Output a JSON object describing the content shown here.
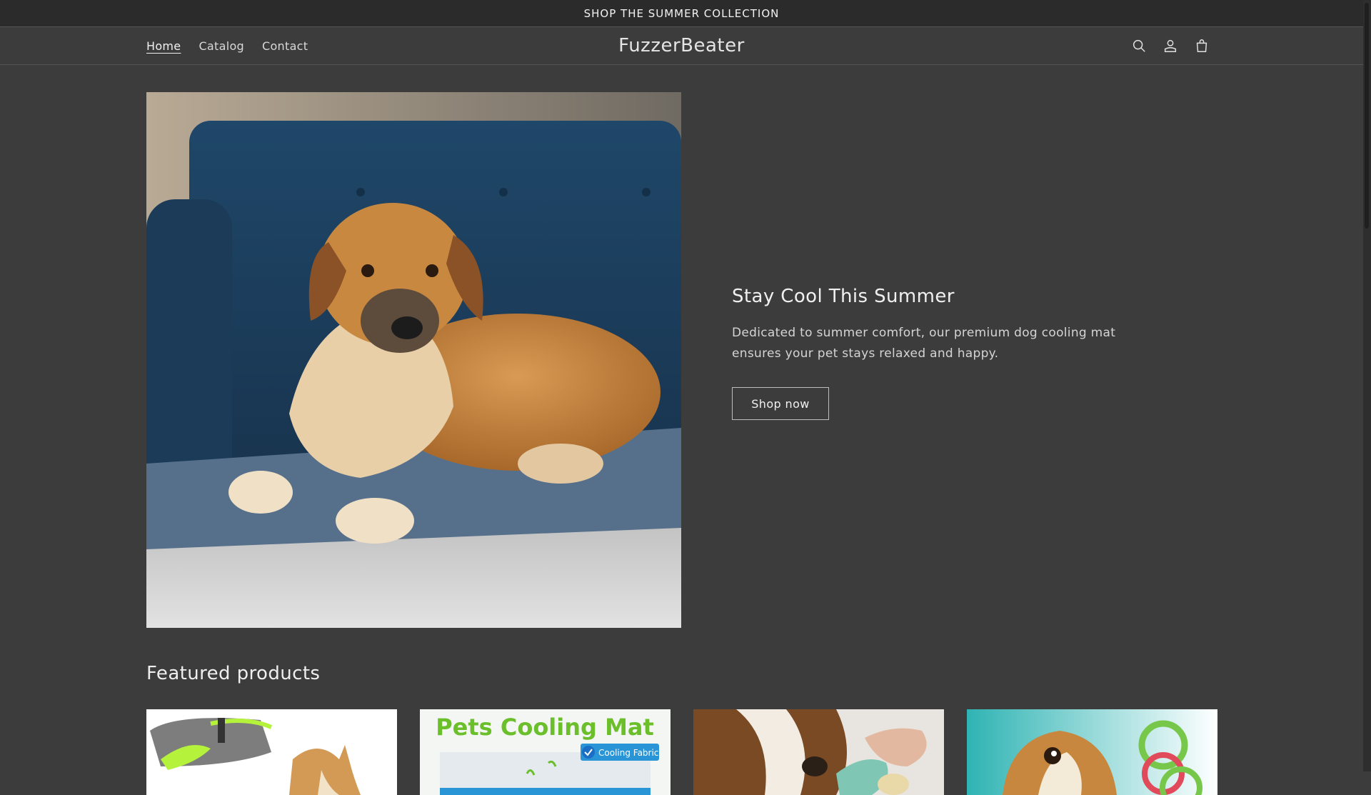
{
  "announcement": {
    "text": "SHOP THE SUMMER COLLECTION"
  },
  "header": {
    "nav": [
      {
        "label": "Home",
        "active": true
      },
      {
        "label": "Catalog"
      },
      {
        "label": "Contact"
      }
    ],
    "logo": "FuzzerBeater",
    "icons": [
      "search-icon",
      "account-icon",
      "cart-icon"
    ]
  },
  "hero": {
    "image": "dog-on-cooling-mat",
    "title": "Stay Cool This Summer",
    "description": "Dedicated to summer comfort, our premium dog cooling mat ensures your pet stays relaxed and happy.",
    "button": "Shop now"
  },
  "featured": {
    "title": "Featured products",
    "products": [
      {
        "image": "cooling-vest-dog"
      },
      {
        "image": "pets-cooling-mat",
        "image_text": "Pets Cooling Mat",
        "badge_text": "Cooling Fabric"
      },
      {
        "image": "beagle-with-toy"
      },
      {
        "image": "dog-ring-toys"
      }
    ]
  },
  "colors": {
    "background": "#3c3c3c",
    "announcement_bg": "#2b2b2b",
    "text": "#e8e8e8",
    "border": "#555555"
  }
}
